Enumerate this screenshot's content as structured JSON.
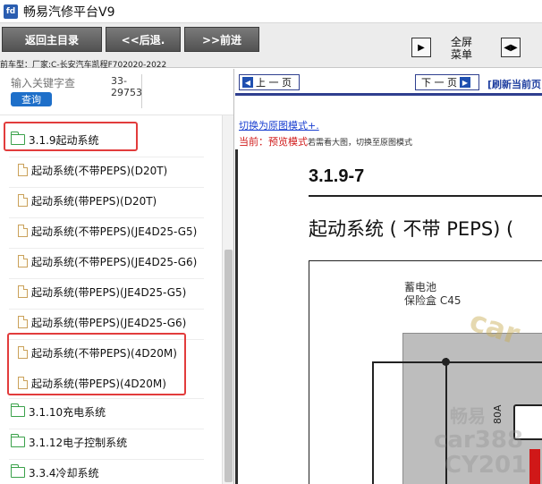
{
  "app": {
    "title": "畅易汽修平台V9",
    "icon_text": "fd"
  },
  "toolbar": {
    "home_label": "返回主目录",
    "back_label": "<<后退.",
    "forward_label": ">>前进",
    "fullscreen_label_line1": "全屏",
    "fullscreen_label_line2": "菜单",
    "current_car": "前车型：厂家:C-长安汽车凯程F702020-2022"
  },
  "search": {
    "placeholder": "输入关键字查",
    "button_label": "查询",
    "code_line1": "33-",
    "code_line2": "29753"
  },
  "tree": {
    "items": [
      {
        "label": "3.1.9起动系统",
        "type": "folder"
      },
      {
        "label": "起动系统(不带PEPS)(D20T)",
        "type": "doc"
      },
      {
        "label": "起动系统(带PEPS)(D20T)",
        "type": "doc"
      },
      {
        "label": "起动系统(不带PEPS)(JE4D25-G5)",
        "type": "doc"
      },
      {
        "label": "起动系统(不带PEPS)(JE4D25-G6)",
        "type": "doc"
      },
      {
        "label": "起动系统(带PEPS)(JE4D25-G5)",
        "type": "doc"
      },
      {
        "label": "起动系统(带PEPS)(JE4D25-G6)",
        "type": "doc"
      },
      {
        "label": "起动系统(不带PEPS)(4D20M)",
        "type": "doc"
      },
      {
        "label": "起动系统(带PEPS)(4D20M)",
        "type": "doc"
      },
      {
        "label": "3.1.10充电系统",
        "type": "folder"
      },
      {
        "label": "3.1.12电子控制系统",
        "type": "folder"
      },
      {
        "label": "3.3.4冷却系统",
        "type": "folder"
      }
    ]
  },
  "viewer": {
    "prev_label": "上 一 页",
    "next_label": "下 一 页",
    "refresh_label": "[刷新当前页",
    "mode_link": "切换为原图模式+.",
    "mode_current_prefix": "当前：",
    "mode_current_value": "预览模式",
    "mode_hint": "若需看大图，切换至原图模式",
    "section_number": "3.1.9-7",
    "doc_title": "起动系统 ( 不带 PEPS) (",
    "battery_line1": "蓄电池",
    "battery_line2": "保险盒 C45",
    "fuse_rating": "80A",
    "watermarks": [
      "car",
      "畅易",
      "car388",
      "CY201"
    ]
  },
  "colors": {
    "highlight": "#e23c3c",
    "toolbar_button": "#5e5e5e",
    "nav_accent": "#2f3f8f",
    "link": "#1a3fd0",
    "warning_text": "#d01a1a",
    "folder": "#3aa14a"
  }
}
